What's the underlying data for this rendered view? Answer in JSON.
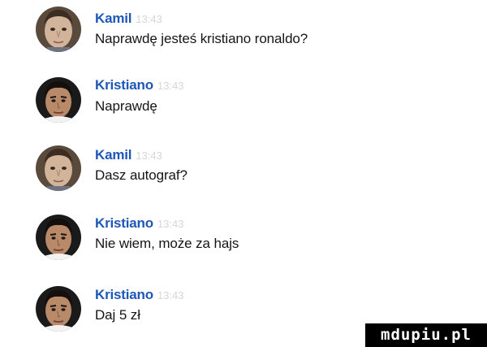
{
  "messages": [
    {
      "author": "Kamil",
      "time": "13:43",
      "text": "Naprawdę jesteś kristiano ronaldo?",
      "avatar": "kid-photo-avatar"
    },
    {
      "author": "Kristiano",
      "time": "13:43",
      "text": "Naprawdę",
      "avatar": "ronaldo-photo-avatar"
    },
    {
      "author": "Kamil",
      "time": "13:43",
      "text": "Dasz autograf?",
      "avatar": "kid-photo-avatar"
    },
    {
      "author": "Kristiano",
      "time": "13:43",
      "text": "Nie wiem, może za hajs",
      "avatar": "ronaldo-photo-avatar"
    },
    {
      "author": "Kristiano",
      "time": "13:43",
      "text": "Daj 5 zł",
      "avatar": "ronaldo-photo-avatar"
    }
  ],
  "watermark": {
    "text": "mdupiu.pl"
  },
  "colors": {
    "author_name": "#1e57b8",
    "timestamp": "#d6d6d6",
    "message_text": "#151515"
  }
}
